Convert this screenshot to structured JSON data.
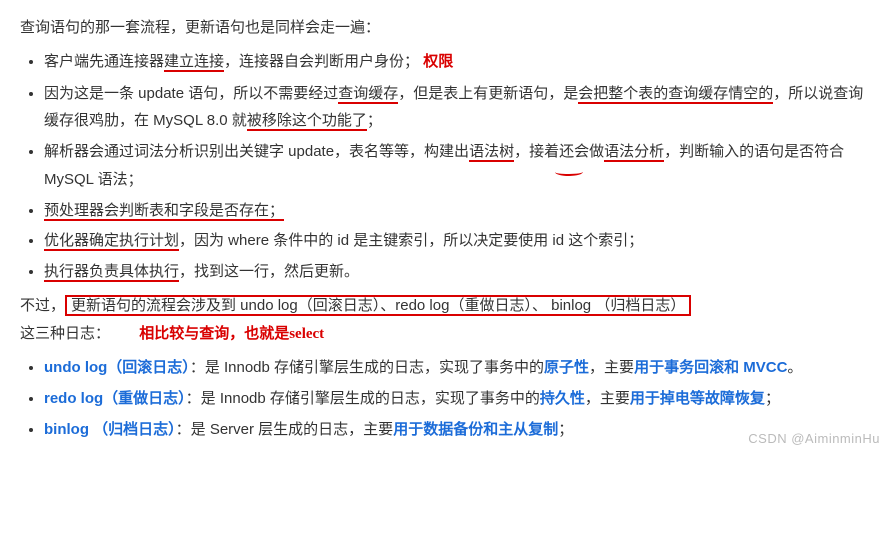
{
  "intro": "查询语句的那一套流程，更新语句也是同样会走一遍：",
  "list1": {
    "item1": {
      "a": "客户端先通连接器",
      "b_u": "建立连接",
      "c": "，连接器自会判断用户身份；",
      "hand": "权限"
    },
    "item2": {
      "a": "因为这是一条 update 语句，所以不需要经过",
      "b_u": "查询缓存",
      "c": "，但是表上有更新语句，是",
      "d_u": "会把整个表的查询缓存情空的",
      "e": "，所以说查询缓存很鸡肋，在 MySQL 8.0 就",
      "f_u": "被移除这个功能了",
      "g": "；"
    },
    "item3": {
      "a": "解析器会通过词法分析识别出关键字 update，表名等等，构建出",
      "b_u": "语法树",
      "c": "，接着还会做",
      "d_u": "语法分析",
      "e": "，判断输入的语句是否符合 MySQL 语法；"
    },
    "item4": {
      "a_u": "预处理器会判断表和字段是否存在；"
    },
    "item5": {
      "a_u": "优化器确定执行计划",
      "b": "，因为 where 条件中的 id 是主键索引，所以决定要使用 id 这个索引；"
    },
    "item6": {
      "a_u": "执行器负责具体执行",
      "b": "，找到这一行，然后更新。"
    }
  },
  "para2": {
    "a": "不过，",
    "box": "更新语句的流程会涉及到 undo log（回滚日志）、redo log（重做日志）、 binlog （归档日志）",
    "b": "这三种日志："
  },
  "hand2": "相比较与查询，也就是select",
  "list2": {
    "item1": {
      "bold": "undo log（回滚日志）",
      "a": "：是 Innodb 存储引擎层生成的日志，实现了事务中的",
      "k1": "原子性",
      "b": "，主要",
      "k2": "用于事务回滚和 MVCC",
      "c": "。"
    },
    "item2": {
      "bold": "redo log（重做日志）",
      "a": "：是 Innodb 存储引擎层生成的日志，实现了事务中的",
      "k1": "持久性",
      "b": "，主要",
      "k2": "用于掉电等故障恢复",
      "c": "；"
    },
    "item3": {
      "bold": "binlog （归档日志）",
      "a": "：是 Server 层生成的日志，主要",
      "k1": "用于数据备份和主从复制",
      "b": "；"
    }
  },
  "watermark1": "CSDN @AiminminHu",
  "watermark2": ""
}
